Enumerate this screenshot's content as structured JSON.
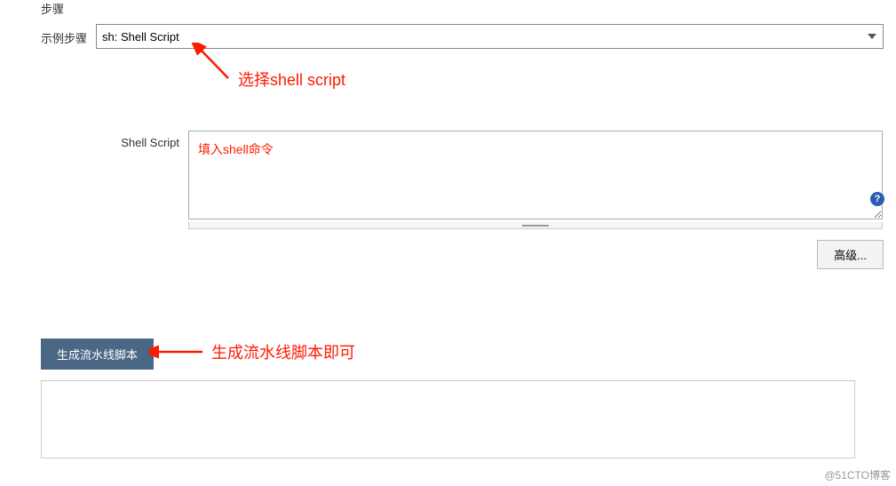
{
  "section_title": "步骤",
  "sample_step_label": "示例步骤",
  "sample_step_selected": "sh: Shell Script",
  "annotation_select": "选择shell script",
  "shell_script_label": "Shell Script",
  "shell_script_placeholder": "填入shell命令",
  "help_tooltip": "?",
  "advanced_button": "高级...",
  "generate_button": "生成流水线脚本",
  "annotation_generate": "生成流水线脚本即可",
  "watermark": "@51CTO博客"
}
